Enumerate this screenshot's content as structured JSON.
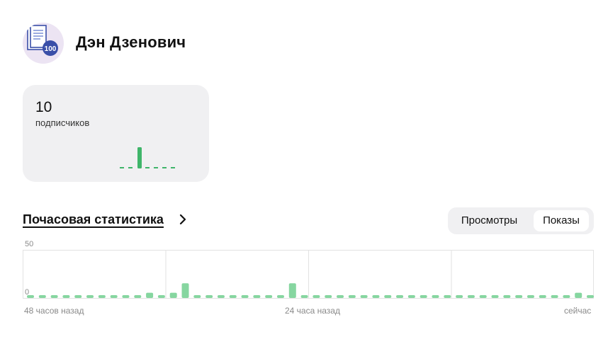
{
  "channel": {
    "name": "Дэн Дзенович",
    "avatar_icon": "document-stack-icon",
    "avatar_badge": "100"
  },
  "subscribers": {
    "count": "10",
    "label": "подписчиков",
    "bar_color": "#3fb56a",
    "chart_data": {
      "type": "bar",
      "values": [
        0,
        0,
        10,
        0,
        0,
        0,
        0
      ]
    }
  },
  "hourly_stats": {
    "title": "Почасовая статистика",
    "chevron_icon": "chevron-right-icon",
    "toggle": {
      "options": [
        "Просмотры",
        "Показы"
      ],
      "selected": "Показы"
    },
    "y_axis": {
      "max_label": "50",
      "min_label": "0"
    },
    "x_labels": {
      "start": "48 часов назад",
      "middle": "24 часа назад",
      "end": "сейчас"
    },
    "bar_color": "#86d6a0",
    "chart_data": {
      "type": "bar",
      "ylim": [
        0,
        50
      ],
      "grid": true,
      "values": [
        0,
        0,
        0,
        0,
        0,
        0,
        0,
        0,
        0,
        0,
        1,
        0,
        1,
        11,
        0,
        0,
        0,
        0,
        0,
        0,
        0,
        0,
        11,
        0,
        0,
        0,
        0,
        0,
        0,
        0,
        0,
        0,
        0,
        0,
        0,
        0,
        0,
        0,
        0,
        0,
        0,
        0,
        0,
        0,
        0,
        0,
        1,
        0
      ]
    }
  }
}
